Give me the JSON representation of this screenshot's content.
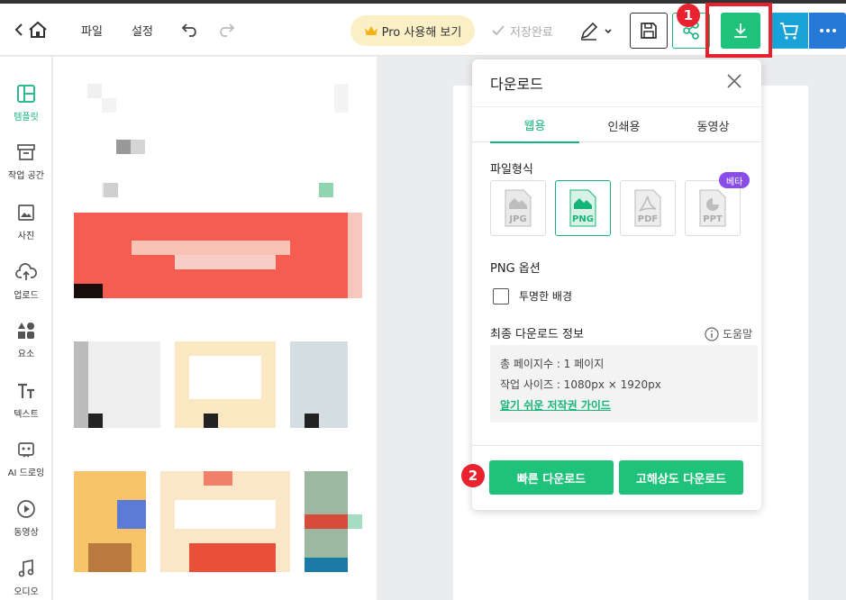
{
  "topbar": {
    "menu_file": "파일",
    "menu_settings": "설정",
    "pro_label": "Pro 사용해 보기",
    "saved_label": "저장완료"
  },
  "annotations": {
    "badge_1": "1",
    "badge_2": "2"
  },
  "sidebar": {
    "items": [
      {
        "label": "템플릿",
        "icon": "template-icon"
      },
      {
        "label": "작업 공간",
        "icon": "archive-icon"
      },
      {
        "label": "사진",
        "icon": "image-icon"
      },
      {
        "label": "업로드",
        "icon": "cloud-upload-icon"
      },
      {
        "label": "요소",
        "icon": "shapes-icon"
      },
      {
        "label": "텍스트",
        "icon": "text-icon"
      },
      {
        "label": "AI 드로잉",
        "icon": "ai-robot-icon"
      },
      {
        "label": "동영상",
        "icon": "play-icon"
      },
      {
        "label": "오디오",
        "icon": "music-icon"
      }
    ]
  },
  "download_popup": {
    "title": "다운로드",
    "tabs": [
      "웹용",
      "인쇄용",
      "동영상"
    ],
    "file_format_label": "파일형식",
    "formats": [
      "JPG",
      "PNG",
      "PDF",
      "PPT"
    ],
    "selected_format": "PNG",
    "beta_label": "베타",
    "png_options_label": "PNG 옵션",
    "transparent_bg_label": "투명한 배경",
    "final_info_label": "최종 다운로드 정보",
    "help_label": "도움말",
    "total_pages": "총 페이지수 : 1 페이지",
    "work_size": "작업 사이즈 : 1080px × 1920px",
    "copyright_link": "알기 쉬운 저작권 가이드",
    "quick_download": "빠른 다운로드",
    "hd_download": "고해상도 다운로드"
  },
  "colors": {
    "accent_green": "#1ec27a",
    "highlight_red": "#e8222e",
    "cart_blue": "#1aa3d6",
    "more_blue": "#2679d6",
    "beta_purple": "#8a4de8",
    "pro_yellow": "#fbefc6"
  }
}
